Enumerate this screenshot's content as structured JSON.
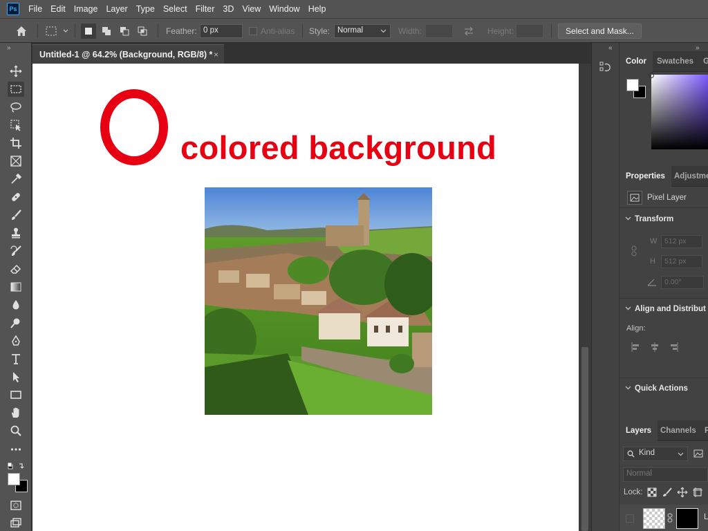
{
  "app": {
    "logo_text": "Ps",
    "menu": [
      "File",
      "Edit",
      "Image",
      "Layer",
      "Type",
      "Select",
      "Filter",
      "3D",
      "View",
      "Window",
      "Help"
    ]
  },
  "options": {
    "feather_label": "Feather:",
    "feather_value": "0 px",
    "antialias_label": "Anti-alias",
    "style_label": "Style:",
    "style_value": "Normal",
    "width_label": "Width:",
    "height_label": "Height:",
    "select_mask_label": "Select and Mask..."
  },
  "document": {
    "tab_title": "Untitled-1 @ 64.2% (Background, RGB/8) *",
    "close_glyph": "×",
    "canvas_text": "colored background",
    "canvas_text_color": "#e60012"
  },
  "tools": [
    "move-tool-icon",
    "rectangular-marquee-icon",
    "lasso-icon",
    "object-selection-icon",
    "crop-icon",
    "frame-icon",
    "eyedropper-icon",
    "healing-brush-icon",
    "brush-icon",
    "clone-stamp-icon",
    "history-brush-icon",
    "eraser-icon",
    "gradient-icon",
    "blur-icon",
    "dodge-icon",
    "pen-icon",
    "type-icon",
    "path-selection-icon",
    "rectangle-icon",
    "hand-icon",
    "zoom-icon",
    "more-tools-icon"
  ],
  "color_panel": {
    "tabs": [
      "Color",
      "Swatches",
      "G"
    ],
    "active_tab": "Color"
  },
  "properties_panel": {
    "tabs": [
      "Properties",
      "Adjustme"
    ],
    "layer_type": "Pixel Layer",
    "transform_label": "Transform",
    "w_label": "W",
    "w_value": "512 px",
    "h_label": "H",
    "h_value": "512 px",
    "angle_value": "0.00°",
    "align_section": "Align and Distribut",
    "align_label": "Align:",
    "quick_actions": "Quick Actions"
  },
  "layers_panel": {
    "tabs": [
      "Layers",
      "Channels",
      "P"
    ],
    "filter_kind": "Kind",
    "blend_mode": "Normal",
    "lock_label": "Lock:",
    "layer_name": "L"
  }
}
